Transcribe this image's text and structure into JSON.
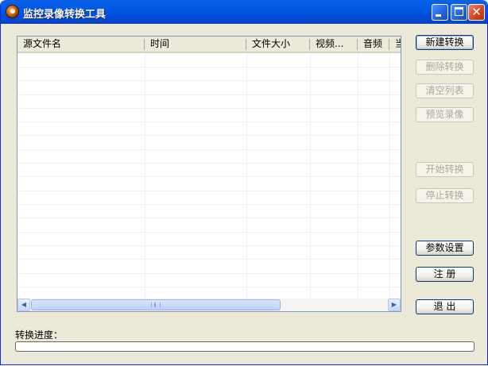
{
  "window": {
    "title": "监控录像转换工具"
  },
  "titlebar_buttons": {
    "minimize": "",
    "maximize": "",
    "close": "✕"
  },
  "list": {
    "columns": [
      "源文件名",
      "时间",
      "文件大小",
      "视频...",
      "音频",
      "当"
    ],
    "rows": []
  },
  "scrollbar": {
    "left_arrow": "◀",
    "right_arrow": "▶"
  },
  "buttons": {
    "new_convert": "新建转换",
    "delete_convert": "删除转换",
    "clear_list": "清空列表",
    "preview": "预览录像",
    "start_convert": "开始转换",
    "stop_convert": "停止转换",
    "settings": "参数设置",
    "register": "注 册",
    "exit": "退 出"
  },
  "progress": {
    "label": "转换进度：",
    "value": 0
  },
  "colors": {
    "titlebar": "#0058e6",
    "window_bg": "#ece9d8",
    "progress_fill": "#2fb82f"
  }
}
